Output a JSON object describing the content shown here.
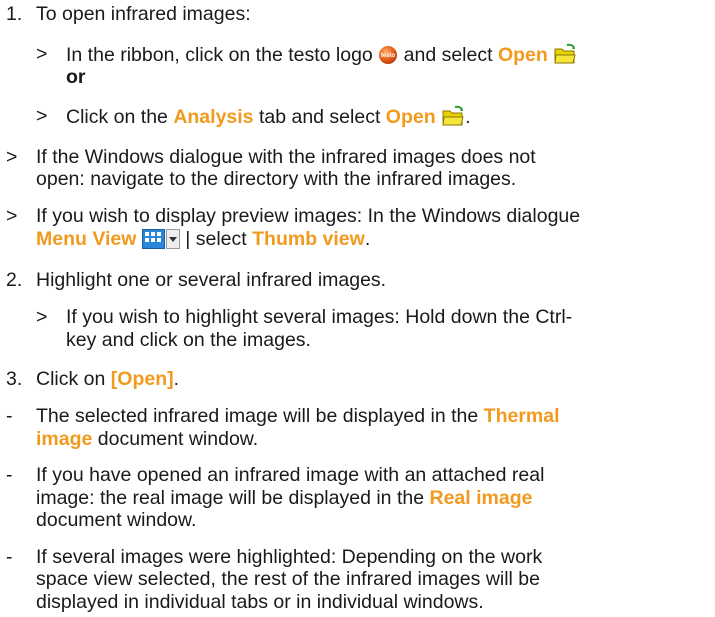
{
  "step1": {
    "marker": "1.",
    "text": "To open infrared images:",
    "sub1": {
      "marker": ">",
      "text1": "In the ribbon, click on the testo logo",
      "text2": "and select",
      "open": "Open",
      "or": "or"
    },
    "sub2": {
      "marker": ">",
      "text1": "Click on the",
      "analysis": "Analysis",
      "text2": "tab and select",
      "open": "Open",
      "end": "."
    }
  },
  "note1": {
    "marker": ">",
    "line1": "If the Windows dialogue with the infrared images does not",
    "line2": "open: navigate to the directory with the infrared images."
  },
  "note2": {
    "marker": ">",
    "line1": "If you wish to display preview images: In the Windows dialogue",
    "menu_view": "Menu View",
    "sep": "| select",
    "thumb": "Thumb view",
    "end": "."
  },
  "step2": {
    "marker": "2.",
    "text": "Highlight one or several infrared images.",
    "sub": {
      "marker": ">",
      "line1": "If you wish to highlight several images: Hold down the Ctrl-",
      "line2": "key and click on the images."
    }
  },
  "step3": {
    "marker": "3.",
    "text": "Click on",
    "open_btn": "[Open]",
    "end": "."
  },
  "result1": {
    "marker": "-",
    "line1a": "The selected infrared image will be displayed in the",
    "thermal1": "Thermal",
    "thermal2": "image",
    "line2b": "document window."
  },
  "result2": {
    "marker": "-",
    "line1": "If you have opened an infrared image with an attached real",
    "line2a": "image: the real image will be displayed in the",
    "real": "Real image",
    "line3": "document window."
  },
  "result3": {
    "marker": "-",
    "line1": "If several images were highlighted: Depending on the work",
    "line2": "space view selected, the rest of the infrared images will be",
    "line3": "displayed in individual tabs or in individual windows."
  },
  "icons": {
    "testo_logo": "testo",
    "folder_color": "#e9d000",
    "highlight_color": "#f29a1e"
  }
}
